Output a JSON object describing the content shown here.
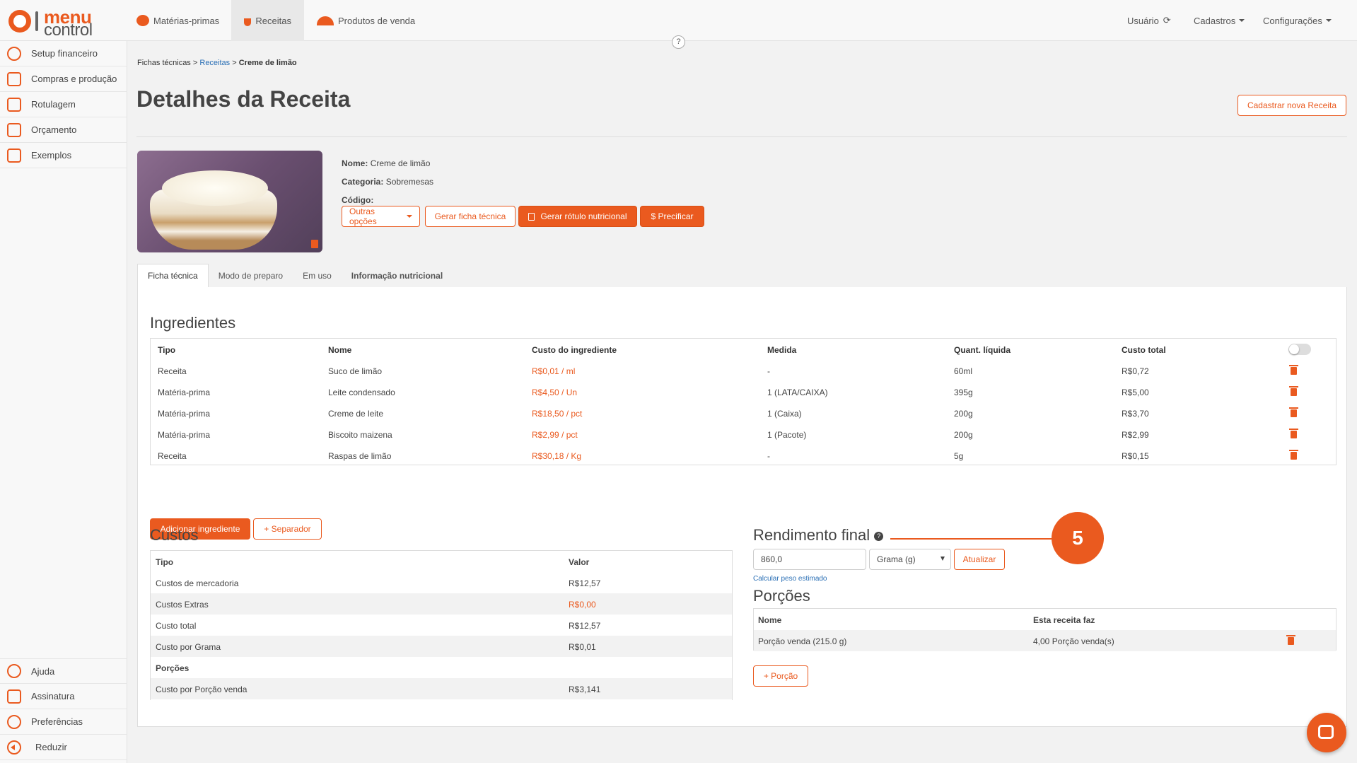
{
  "brand": {
    "line1": "menu",
    "line2": "control"
  },
  "topnav": [
    {
      "label": "Matérias-primas",
      "icon": "tomato-icon"
    },
    {
      "label": "Receitas",
      "icon": "bowl-icon"
    },
    {
      "label": "Produtos de venda",
      "icon": "cloche-icon"
    }
  ],
  "topright": {
    "user": "Usuário",
    "cadastros": "Cadastros",
    "config": "Configurações"
  },
  "help_label": "?",
  "sidebar": {
    "top": [
      "Setup financeiro",
      "Compras e produção",
      "Rotulagem",
      "Orçamento",
      "Exemplos"
    ],
    "bottom": [
      "Ajuda",
      "Assinatura",
      "Preferências",
      "Reduzir"
    ]
  },
  "breadcrumb": {
    "a": "Fichas técnicas",
    "sep": ">",
    "b": "Receitas",
    "c": "Creme de limão"
  },
  "page_title": "Detalhes da Receita",
  "new_recipe_button": "Cadastrar nova Receita",
  "recipe": {
    "name_label": "Nome:",
    "name": "Creme de limão",
    "category_label": "Categoria:",
    "category": "Sobremesas",
    "code_label": "Código:",
    "code": ""
  },
  "actions": {
    "other": "Outras opções",
    "sheet": "Gerar ficha técnica",
    "label": "Gerar rótulo nutricional",
    "price": "$ Precificar"
  },
  "tabs": [
    "Ficha técnica",
    "Modo de preparo",
    "Em uso",
    "Informação nutricional"
  ],
  "ingredients": {
    "title": "Ingredientes",
    "headers": [
      "Tipo",
      "Nome",
      "Custo do ingrediente",
      "Medida",
      "Quant. líquida",
      "Custo total"
    ],
    "rows": [
      [
        "Receita",
        "Suco de limão",
        "R$0,01 / ml",
        "-",
        "60ml",
        "R$0,72"
      ],
      [
        "Matéria-prima",
        "Leite condensado",
        "R$4,50 / Un",
        "1 (LATA/CAIXA)",
        "395g",
        "R$5,00"
      ],
      [
        "Matéria-prima",
        "Creme de leite",
        "R$18,50 / pct",
        "1 (Caixa)",
        "200g",
        "R$3,70"
      ],
      [
        "Matéria-prima",
        "Biscoito maizena",
        "R$2,99 / pct",
        "1 (Pacote)",
        "200g",
        "R$2,99"
      ],
      [
        "Receita",
        "Raspas de limão",
        "R$30,18 / Kg",
        "-",
        "5g",
        "R$0,15"
      ]
    ],
    "add_button": "Adicionar ingrediente",
    "separator_button": "+ Separador"
  },
  "costs": {
    "title": "Custos",
    "headers": [
      "Tipo",
      "Valor"
    ],
    "rows": [
      [
        "Custos de mercadoria",
        "R$12,57"
      ],
      [
        "Custos Extras",
        "R$0,00"
      ],
      [
        "Custo total",
        "R$12,57"
      ],
      [
        "Custo por Grama",
        "R$0,01"
      ],
      [
        "Porções",
        ""
      ],
      [
        "Custo por Porção venda",
        "R$3,141"
      ]
    ]
  },
  "yield": {
    "title": "Rendimento final",
    "value": "860,0",
    "unit": "Grama (g)",
    "update_button": "Atualizar",
    "estimate_link": "Calcular peso estimado"
  },
  "portions": {
    "title": "Porções",
    "headers": [
      "Nome",
      "Esta receita faz"
    ],
    "rows": [
      [
        "Porção venda (215.0 g)",
        "4,00 Porção venda(s)"
      ]
    ],
    "add_button": "+ Porção"
  },
  "callout": "5",
  "colors": {
    "accent": "#ea5a1f",
    "link": "#2a6fb5"
  }
}
